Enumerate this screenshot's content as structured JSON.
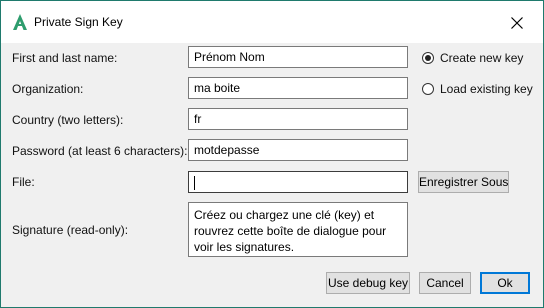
{
  "window": {
    "title": "Private Sign Key"
  },
  "form": {
    "name_label": "First and last name:",
    "name_value": "Prénom Nom",
    "org_label": "Organization:",
    "org_value": "ma boite",
    "country_label": "Country (two letters):",
    "country_value": "fr",
    "password_label": "Password (at least 6 characters):",
    "password_value": "motdepasse",
    "file_label": "File:",
    "file_value": "",
    "signature_label": "Signature (read-only):",
    "signature_text": "Créez ou chargez une clé (key) et rouvrez cette boîte de dialogue pour voir les signatures."
  },
  "options": {
    "create_label": "Create new key",
    "load_label": "Load existing key",
    "selected": "create"
  },
  "buttons": {
    "save_as": "Enregistrer Sous",
    "use_debug": "Use debug key",
    "cancel": "Cancel",
    "ok": "Ok"
  },
  "colors": {
    "accent": "#1f7a6d",
    "icon": "#2e9d6e",
    "focus": "#0078d7"
  },
  "icons": {
    "app": "android-studio-a-icon",
    "close": "close-icon"
  }
}
